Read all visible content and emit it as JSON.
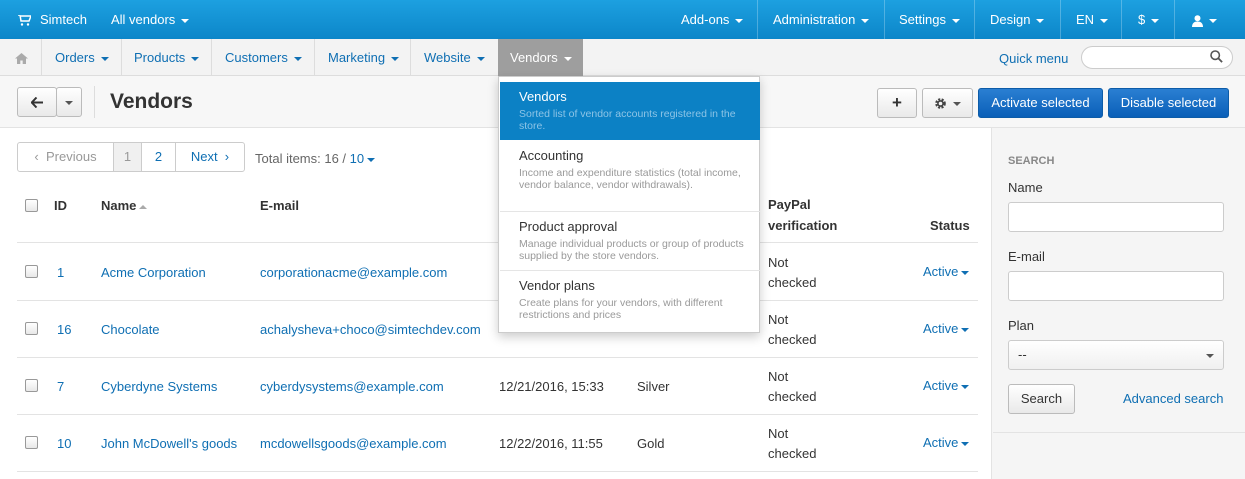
{
  "topbar": {
    "brand": "Simtech",
    "vendor_selector": "All vendors",
    "addons": "Add-ons",
    "administration": "Administration",
    "settings": "Settings",
    "design": "Design",
    "language": "EN",
    "currency": "$"
  },
  "nav": {
    "orders": "Orders",
    "products": "Products",
    "customers": "Customers",
    "marketing": "Marketing",
    "website": "Website",
    "vendors": "Vendors",
    "quick_menu": "Quick menu",
    "search_placeholder": ""
  },
  "toolbar": {
    "title": "Vendors",
    "add": "+",
    "activate_selected": "Activate selected",
    "disable_selected": "Disable selected"
  },
  "pagination": {
    "previous": "Previous",
    "pages": [
      "1",
      "2"
    ],
    "next": "Next",
    "total_label": "Total items: 16 / ",
    "per_page": "10"
  },
  "table": {
    "headers": {
      "id": "ID",
      "name": "Name",
      "email": "E-mail",
      "paypal_line1": "PayPal",
      "paypal_line2": "verification",
      "status": "Status"
    },
    "rows": [
      {
        "id": "1",
        "name": "Acme Corporation",
        "email": "corporationacme@example.com",
        "date": "",
        "plan": "",
        "paypal1": "Not",
        "paypal2": "checked",
        "status": "Active"
      },
      {
        "id": "16",
        "name": "Chocolate",
        "email": "achalysheva+choco@simtechdev.com",
        "date": "",
        "plan": "",
        "paypal1": "Not",
        "paypal2": "checked",
        "status": "Active"
      },
      {
        "id": "7",
        "name": "Cyberdyne Systems",
        "email": "cyberdysystems@example.com",
        "date": "12/21/2016, 15:33",
        "plan": "Silver",
        "paypal1": "Not",
        "paypal2": "checked",
        "status": "Active"
      },
      {
        "id": "10",
        "name": "John McDowell's goods",
        "email": "mcdowellsgoods@example.com",
        "date": "12/22/2016, 11:55",
        "plan": "Gold",
        "paypal1": "Not",
        "paypal2": "checked",
        "status": "Active"
      }
    ]
  },
  "sidebar": {
    "heading": "SEARCH",
    "name_label": "Name",
    "email_label": "E-mail",
    "plan_label": "Plan",
    "plan_value": "--",
    "search_button": "Search",
    "advanced_search": "Advanced search"
  },
  "dropdown": {
    "items": [
      {
        "title": "Vendors",
        "desc": "Sorted list of vendor accounts registered in the store."
      },
      {
        "title": "Accounting",
        "desc": "Income and expenditure statistics (total income, vendor balance, vendor withdrawals)."
      },
      {
        "title": "Product approval",
        "desc": "Manage individual products or group of products supplied by the store vendors."
      },
      {
        "title": "Vendor plans",
        "desc": "Create plans for your vendors, with different restrictions and prices"
      }
    ]
  },
  "colors": {
    "topbar": "#0f93d6",
    "link": "#0f6fb3",
    "primary_button": "#0a5fb8",
    "menu_highlight": "#0c81c5"
  }
}
